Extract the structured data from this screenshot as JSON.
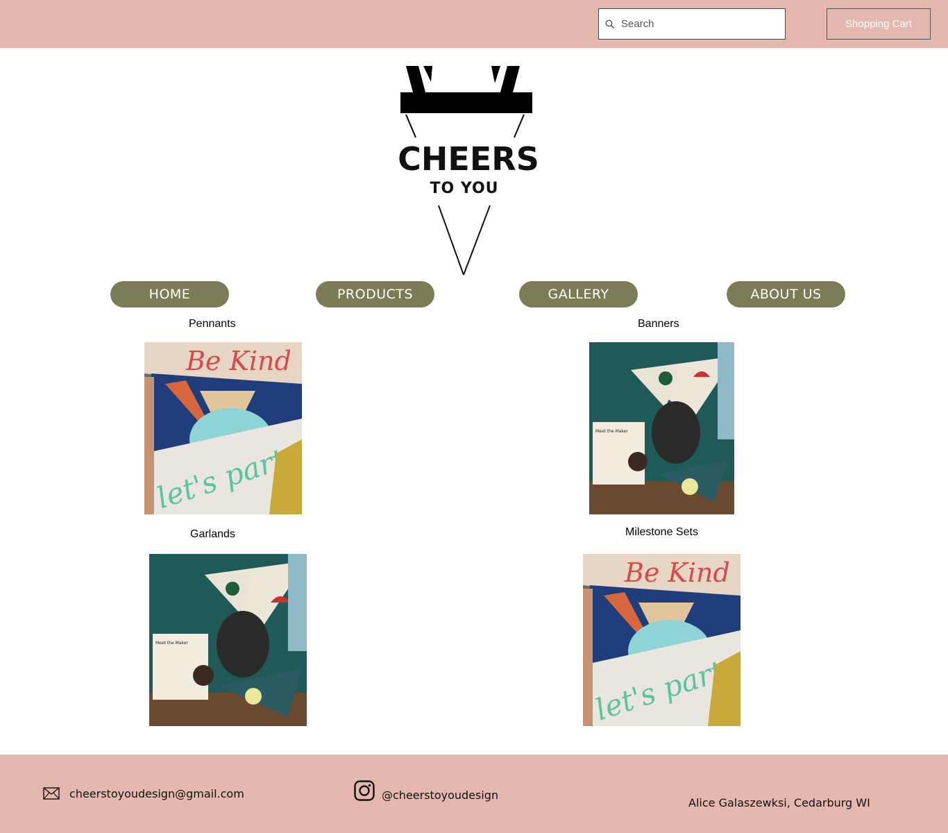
{
  "header": {
    "search_placeholder": "Search",
    "cart_label": "Shopping Cart"
  },
  "logo": {
    "line1": "CHEERS",
    "line2": "TO YOU"
  },
  "nav": [
    {
      "label": "HOME"
    },
    {
      "label": "PRODUCTS"
    },
    {
      "label": "GALLERY"
    },
    {
      "label": "ABOUT US"
    }
  ],
  "categories": [
    {
      "label": "Pennants",
      "photo_icon": "pennant-photo-icon"
    },
    {
      "label": "Banners",
      "photo_icon": "banner-photo-icon"
    },
    {
      "label": "Garlands",
      "photo_icon": "garland-photo-icon"
    },
    {
      "label": "Milestone Sets",
      "photo_icon": "milestone-photo-icon"
    }
  ],
  "photo_text": {
    "be_kind": "Be Kind",
    "lets_party": "let's party",
    "meet_maker": "Meet the Maker"
  },
  "footer": {
    "email": "cheerstoyoudesign@gmail.com",
    "instagram": "@cheerstoyoudesign",
    "address": "Alice Galaszewksi, Cedarburg WI"
  },
  "colors": {
    "header_bg": "#e4b8ae",
    "nav_bg": "#7b7b56",
    "footer_bg": "#e4b8ae"
  }
}
